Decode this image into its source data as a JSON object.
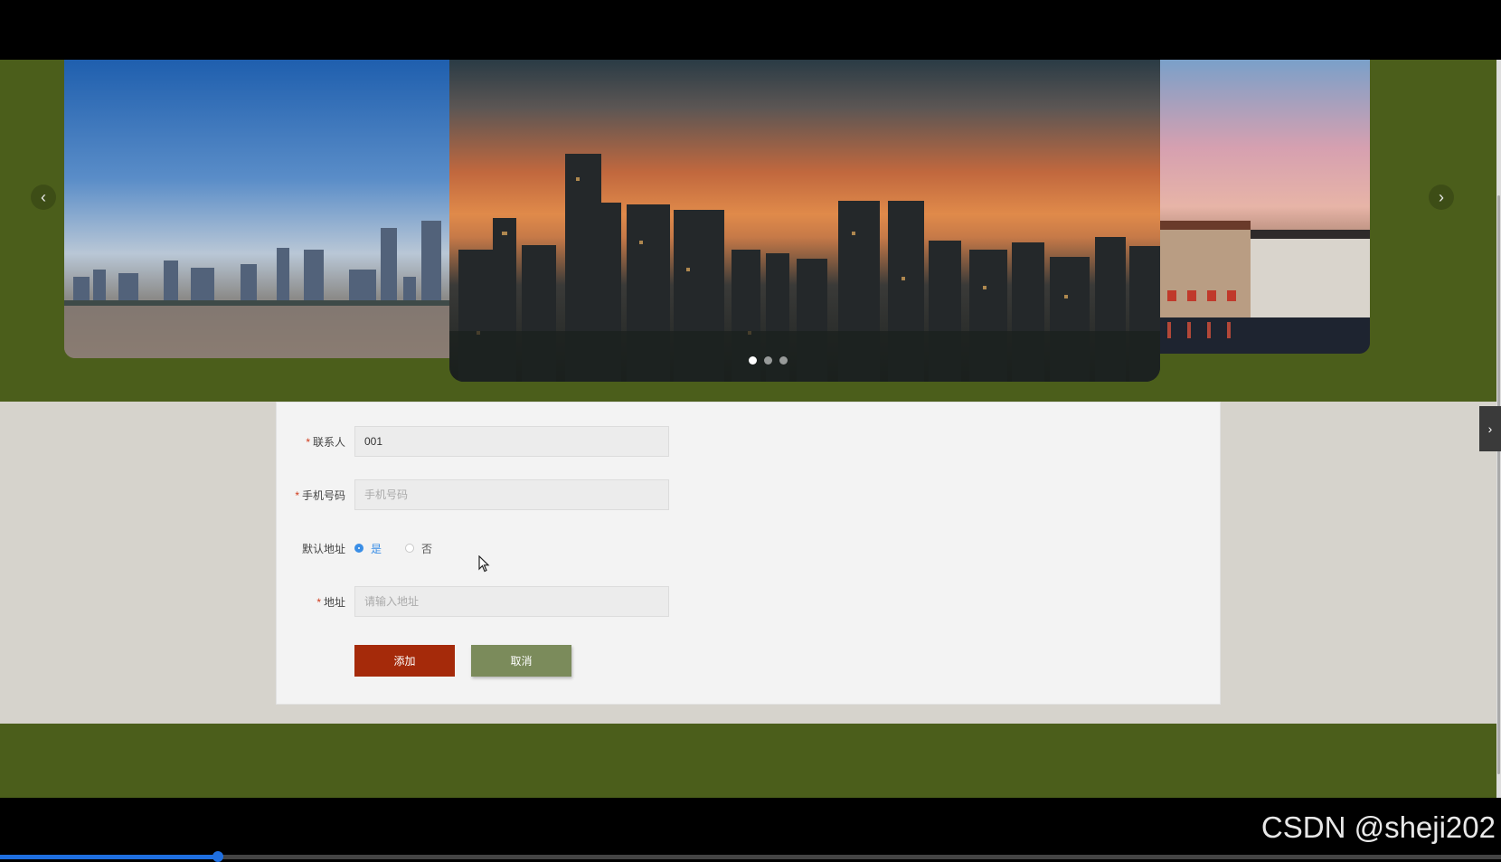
{
  "carousel": {
    "prev_label": "‹",
    "next_label": "›",
    "slides": [
      "slide-1",
      "slide-2",
      "slide-3"
    ],
    "active_slide": 1
  },
  "form": {
    "contact": {
      "label": "联系人",
      "value": "001",
      "required": true
    },
    "phone": {
      "label": "手机号码",
      "placeholder": "手机号码",
      "required": true
    },
    "default_address": {
      "label": "默认地址",
      "options": [
        "是",
        "否"
      ],
      "selected": "是"
    },
    "address": {
      "label": "地址",
      "placeholder": "请输入地址",
      "required": true
    },
    "required_mark": "*",
    "add_label": "添加",
    "cancel_label": "取消"
  },
  "side_toggle": {
    "label": "›"
  },
  "watermark": "CSDN @sheji202",
  "video_progress": 0.145,
  "colors": {
    "page_green": "#4b5e1b",
    "add_button": "#a52a0a",
    "cancel_button": "#7b8b5b",
    "radio_accent": "#3a8ee6",
    "required_red": "#d03a1a"
  }
}
